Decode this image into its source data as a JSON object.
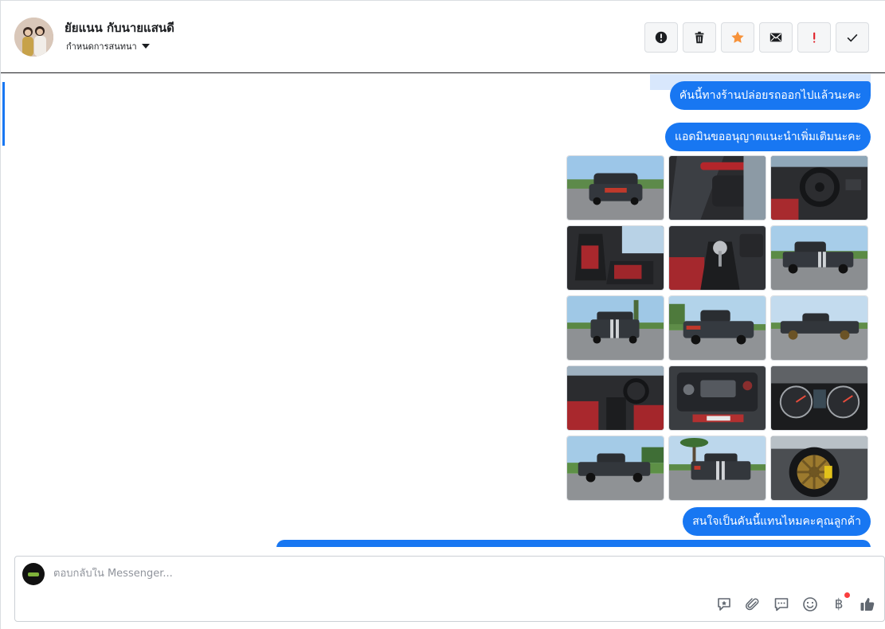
{
  "header": {
    "contact_name": "ยัยแนน กับนายแสนดี",
    "assign_label": "กำหนดการสนทนา"
  },
  "actions": [
    {
      "icon": "alert-circle-icon"
    },
    {
      "icon": "trash-icon"
    },
    {
      "icon": "star-icon",
      "color": "#f7923a"
    },
    {
      "icon": "envelope-icon"
    },
    {
      "icon": "exclamation-icon",
      "color": "#e0242b"
    },
    {
      "icon": "checkmark-icon"
    }
  ],
  "messages": [
    {
      "text": "คันนี้ทางร้านปล่อยรถออกไปแล้วนะคะ"
    },
    {
      "text": "แอดมินขออนุญาตแนะนำเพิ่มเติมนะคะ"
    },
    {
      "text": "สนใจเป็นคันนี้แทนไหมคะคุณลูกค้า"
    }
  ],
  "photos": [
    {
      "subject": "truck-front"
    },
    {
      "subject": "door-interior"
    },
    {
      "subject": "steering-wheel"
    },
    {
      "subject": "front-seats"
    },
    {
      "subject": "gear-shifter"
    },
    {
      "subject": "truck-rear-quarter"
    },
    {
      "subject": "truck-rear"
    },
    {
      "subject": "truck-front-quarter"
    },
    {
      "subject": "truck-side"
    },
    {
      "subject": "cabin-interior"
    },
    {
      "subject": "engine-bay"
    },
    {
      "subject": "gauge-cluster"
    },
    {
      "subject": "truck-side-lawn"
    },
    {
      "subject": "truck-rear-palm"
    },
    {
      "subject": "gold-wheel"
    }
  ],
  "composer": {
    "placeholder": "ตอบกลับใน Messenger..."
  },
  "colors": {
    "bubble": "#1877f2",
    "highlight": "#d8e7fc",
    "notification_dot": "#fa3e3e"
  }
}
